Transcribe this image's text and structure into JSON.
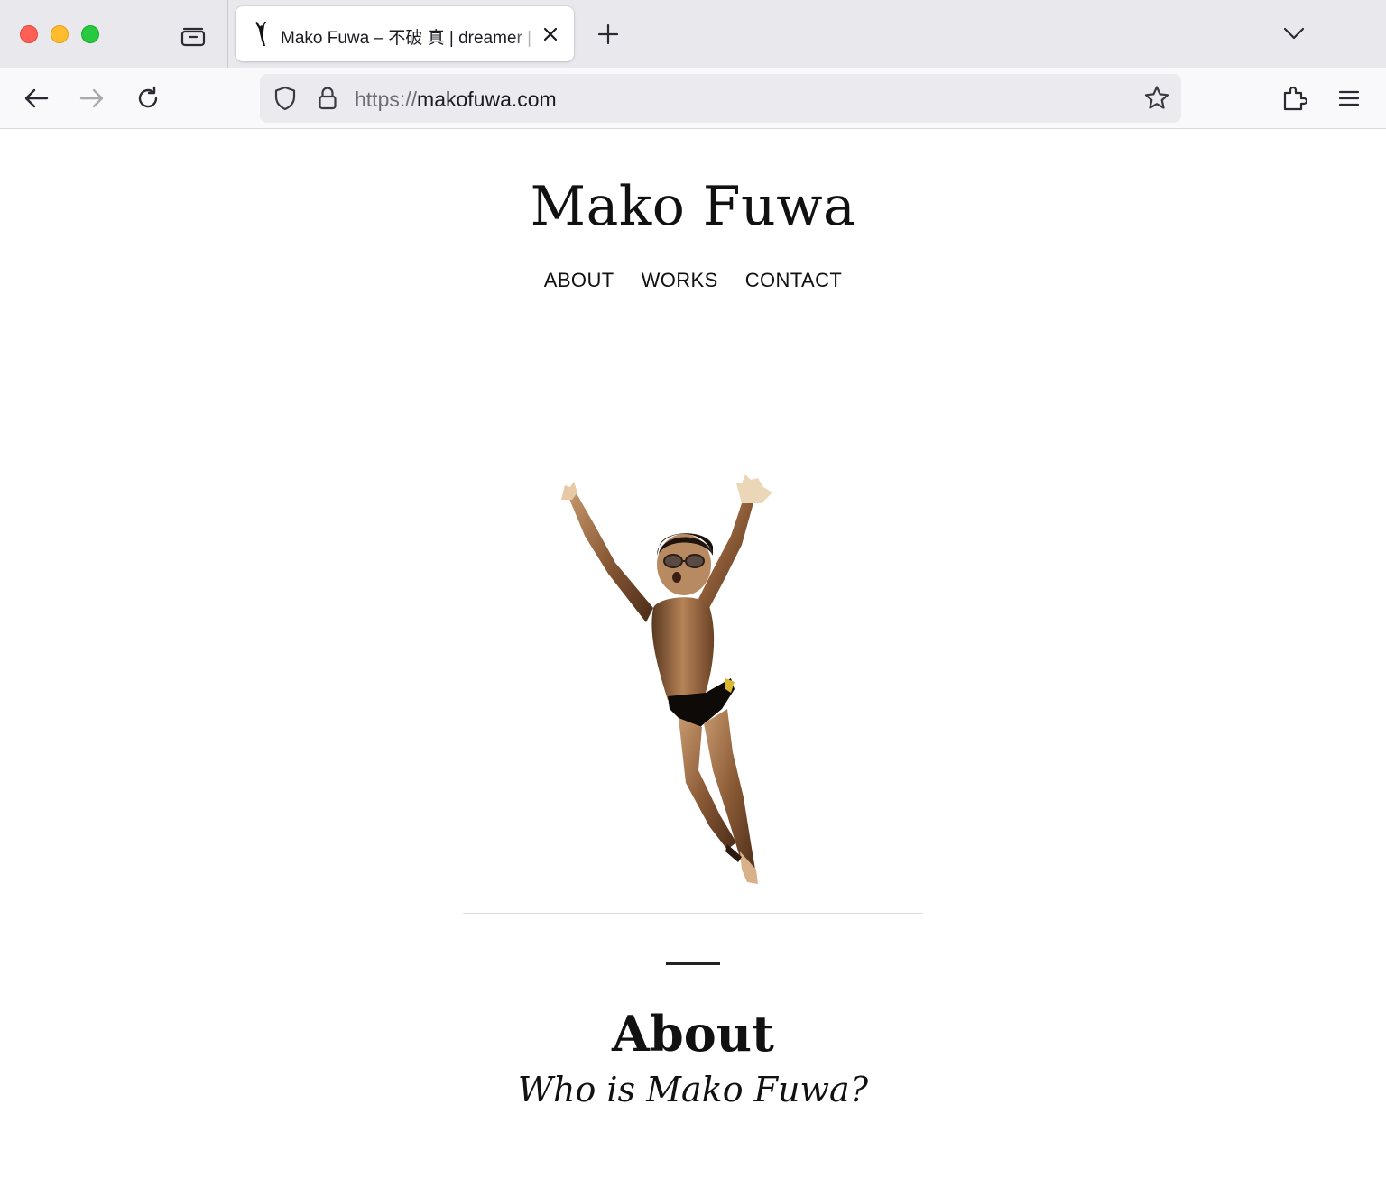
{
  "browser": {
    "tab": {
      "title": "Mako Fuwa – 不破 真 | dreamer | "
    },
    "url": {
      "scheme": "https://",
      "host": "makofuwa.com"
    },
    "icons": {
      "tabs_list": "tabs-tray-icon",
      "close_tab": "close-icon",
      "new_tab": "plus-icon",
      "list_all_tabs": "chevron-down-icon",
      "back": "arrow-left-icon",
      "forward": "arrow-right-icon",
      "reload": "reload-icon",
      "shield": "shield-icon",
      "lock": "lock-icon",
      "bookmark": "star-icon",
      "extensions": "puzzle-icon",
      "menu": "hamburger-menu-icon"
    },
    "colors": {
      "close": "#fe5f57",
      "minimize": "#febc2e",
      "maximize": "#28c840"
    }
  },
  "site": {
    "title": "Mako Fuwa",
    "nav": {
      "about": "ABOUT",
      "works": "WORKS",
      "contact": "CONTACT"
    },
    "about_section": {
      "title": "About",
      "subtitle": "Who is Mako Fuwa?"
    }
  }
}
